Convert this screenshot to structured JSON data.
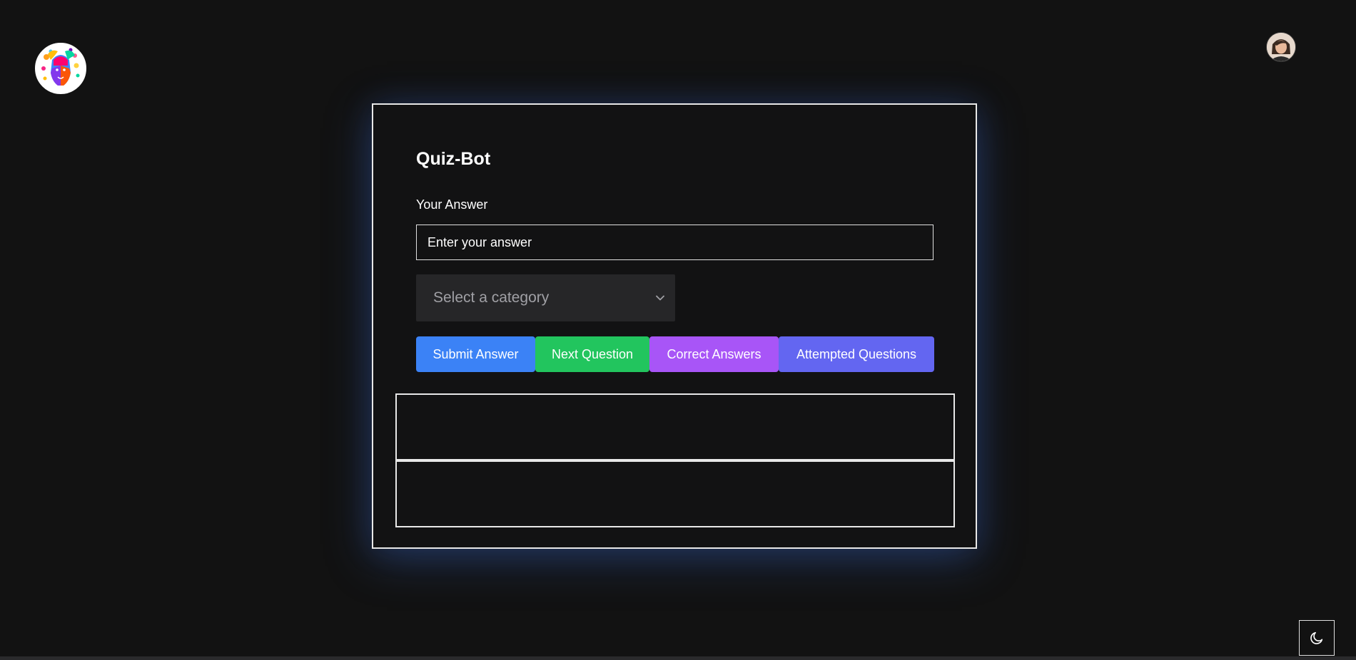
{
  "app": {
    "title": "Quiz-Bot"
  },
  "form": {
    "answer_label": "Your Answer",
    "answer_placeholder": "Enter your answer",
    "answer_value": "",
    "category_placeholder": "Select a category"
  },
  "buttons": [
    {
      "label": "Submit Answer",
      "color": "#3b82f6"
    },
    {
      "label": "Next Question",
      "color": "#22c55e"
    },
    {
      "label": "Correct Answers",
      "color": "#a855f7"
    },
    {
      "label": "Attempted Questions",
      "color": "#6366f1"
    }
  ],
  "icons": {
    "logo": "colorful-face-logo",
    "avatar": "user-avatar",
    "theme_toggle": "moon-icon",
    "select_chevron": "chevron-down-icon"
  },
  "colors": {
    "background": "#121212",
    "card_border": "#e8e8e8",
    "glow": "#3b69c8",
    "select_background": "#262628"
  }
}
